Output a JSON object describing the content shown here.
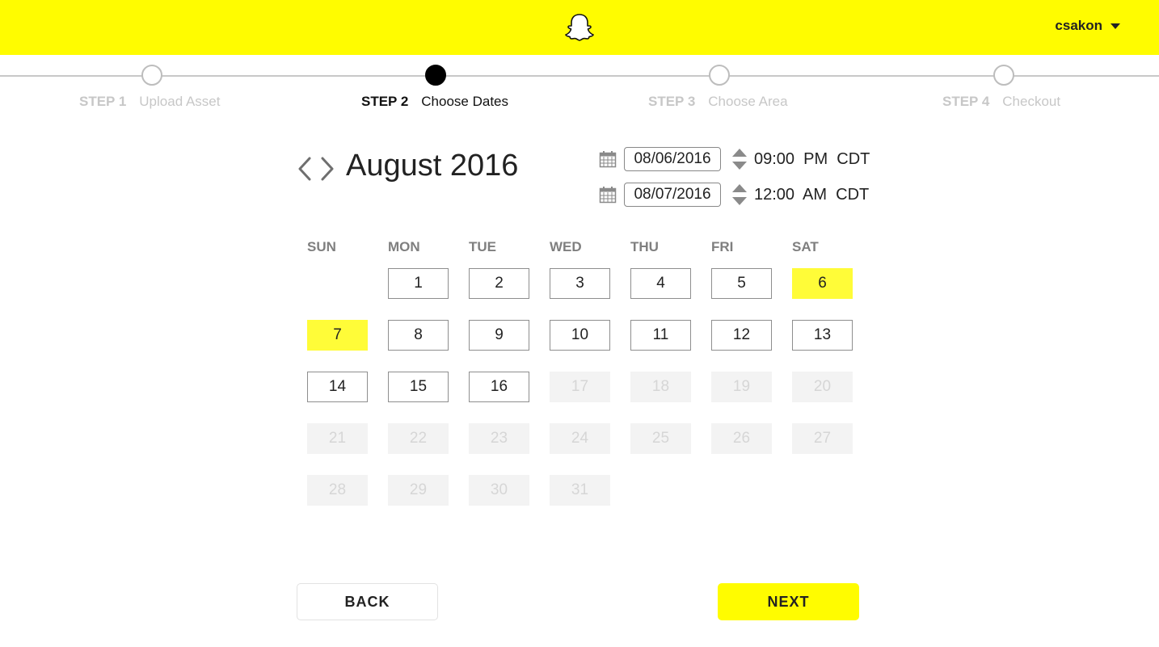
{
  "header": {
    "brand_color": "#fffc00",
    "logo_icon": "snapchat-ghost-icon",
    "username": "csakon"
  },
  "stepper": {
    "steps": [
      {
        "num": "STEP 1",
        "label": "Upload Asset",
        "state": "inactive"
      },
      {
        "num": "STEP 2",
        "label": "Choose Dates",
        "state": "active"
      },
      {
        "num": "STEP 3",
        "label": "Choose Area",
        "state": "inactive"
      },
      {
        "num": "STEP 4",
        "label": "Checkout",
        "state": "inactive"
      }
    ]
  },
  "calendar": {
    "month_title": "August 2016",
    "weekdays": [
      "SUN",
      "MON",
      "TUE",
      "WED",
      "THU",
      "FRI",
      "SAT"
    ],
    "days": [
      "1",
      "2",
      "3",
      "4",
      "5",
      "6",
      "7",
      "8",
      "9",
      "10",
      "11",
      "12",
      "13",
      "14",
      "15",
      "16",
      "17",
      "18",
      "19",
      "20",
      "21",
      "22",
      "23",
      "24",
      "25",
      "26",
      "27",
      "28",
      "29",
      "30",
      "31"
    ],
    "selected_days": [
      "6",
      "7"
    ],
    "available_through": "16",
    "selected_color": "#fffc38"
  },
  "range": {
    "start": {
      "date": "08/06/2016",
      "time": "09:00  PM  CDT"
    },
    "end": {
      "date": "08/07/2016",
      "time": "12:00  AM  CDT"
    }
  },
  "actions": {
    "back_label": "BACK",
    "next_label": "NEXT"
  }
}
